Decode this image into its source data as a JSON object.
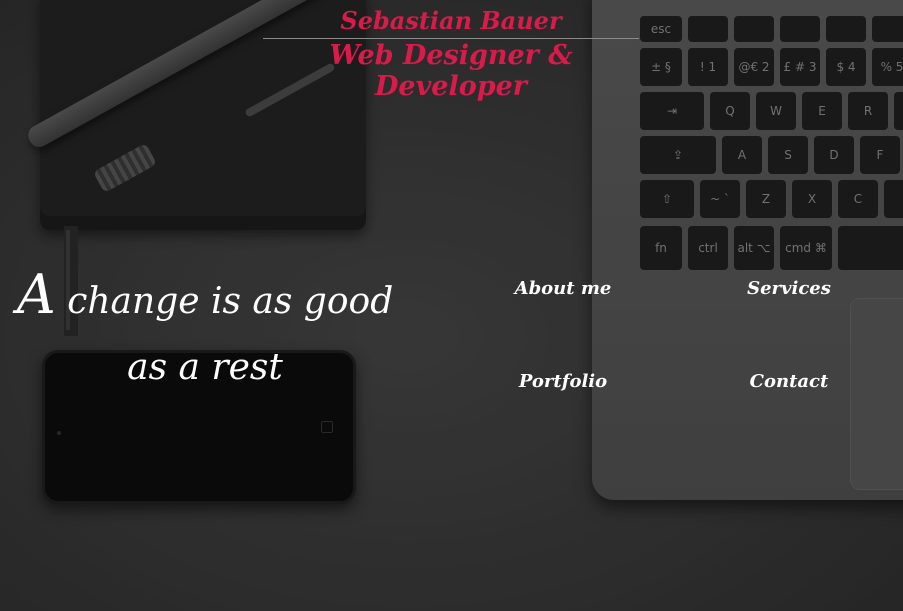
{
  "header": {
    "name": "Sebastian Bauer",
    "role": "Web Designer & Developer"
  },
  "hero": {
    "quote_first": "A",
    "quote_rest": " change is as good as a rest"
  },
  "nav": {
    "about": "About me",
    "services": "Services",
    "portfolio": "Portfolio",
    "contact": "Contact"
  },
  "colors": {
    "accent": "#d81b4a",
    "nav_text": "#ffffff",
    "background": "#3a3a3a"
  },
  "keyboard": {
    "row1": [
      "esc",
      "",
      "",
      "",
      "",
      ""
    ],
    "row2": [
      "± §",
      "! 1",
      "@€ 2",
      "£ # 3",
      "$ 4",
      "% 5"
    ],
    "row3": [
      "⇥",
      "Q",
      "W",
      "E",
      "R",
      ""
    ],
    "row4": [
      "⇪",
      "A",
      "S",
      "D",
      "F"
    ],
    "row5": [
      "⇧",
      "~ `",
      "Z",
      "X",
      "C",
      ""
    ],
    "row6": [
      "fn",
      "ctrl",
      "alt ⌥",
      "cmd ⌘",
      ""
    ]
  }
}
